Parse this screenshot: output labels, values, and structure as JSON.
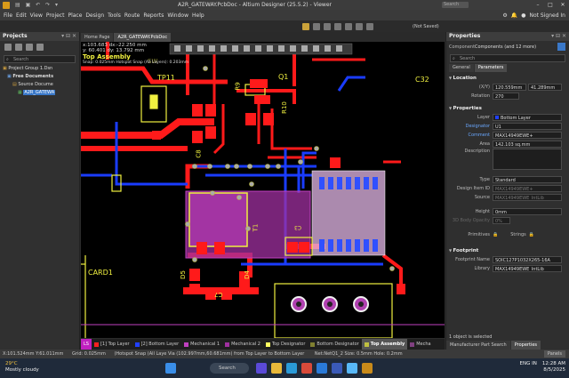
{
  "window": {
    "title": "A2R_GATEWAY.PcbDoc - Altium Designer (25.5.2) - Viewer",
    "search_label": "Search",
    "buttons": [
      "minimize",
      "maximize",
      "close"
    ]
  },
  "menu": {
    "items": [
      "File",
      "Edit",
      "View",
      "Project",
      "Place",
      "Design",
      "Tools",
      "Route",
      "Reports",
      "Window",
      "Help"
    ],
    "not_signed_in": "Not Signed In",
    "not_saved": "(Not Saved)"
  },
  "projects": {
    "title": "Projects",
    "search_placeholder": "Search",
    "tree": [
      {
        "label": "Project Group 1.Dsn",
        "depth": 0
      },
      {
        "label": "Free Documents",
        "depth": 1
      },
      {
        "label": "Source Docume",
        "depth": 2
      },
      {
        "label": "A2R_GATEWA",
        "depth": 3,
        "selected": true
      }
    ]
  },
  "doc_tabs": [
    {
      "label": "Home Page",
      "active": false
    },
    {
      "label": "A2R_GATEWAY.PcbDoc",
      "active": true
    }
  ],
  "hud": {
    "line1": "x:103.683   dx:-22.250 mm",
    "line2": "y: 60.401   dy: 13.792 mm",
    "line3": "Top Assembly",
    "line4": "Snap: 0.025mm Hotspot Snap (All Layers): 0.203mm"
  },
  "pcb_labels": {
    "q1": "Q1",
    "c32": "C32",
    "tp11": "TP11",
    "r9": "R9",
    "r10": "R10",
    "c8": "C8",
    "t1": "T1",
    "d5": "D5",
    "d4": "D4",
    "c7": "C7",
    "card1": "CARD1",
    "sw": "SW",
    "c3": "C3"
  },
  "layers": [
    {
      "label": "LS",
      "color": "#c020c0"
    },
    {
      "label": "[1] Top Layer",
      "color": "#ff2020"
    },
    {
      "label": "[2] Bottom Layer",
      "color": "#2040ff"
    },
    {
      "label": "Mechanical 1",
      "color": "#c040c0"
    },
    {
      "label": "Mechanical 2",
      "color": "#a030a0"
    },
    {
      "label": "Top Designator",
      "color": "#ffff60"
    },
    {
      "label": "Bottom Designator",
      "color": "#808030"
    },
    {
      "label": "Top Assembly",
      "color": "#c0c040",
      "active": true
    },
    {
      "label": "Mecha",
      "color": "#804080"
    }
  ],
  "properties": {
    "title": "Properties",
    "component_label": "Component",
    "component_value": "Components (and 12 more)",
    "search_placeholder": "Search",
    "tabs": [
      "General",
      "Parameters"
    ],
    "location_header": "Location",
    "xy_label": "(X/Y)",
    "x_value": "120.559mm",
    "y_value": "41.289mm",
    "rotation_label": "Rotation",
    "rotation_value": "270",
    "properties_header": "Properties",
    "layer_label": "Layer",
    "layer_value": "Bottom Layer",
    "designator_label": "Designator",
    "designator_value": "U1",
    "comment_label": "Comment",
    "comment_value": "MAX14949EWE+",
    "area_label": "Area",
    "area_value": "142.103 sq.mm",
    "description_label": "Description",
    "type_label": "Type",
    "type_value": "Standard",
    "design_item_label": "Design Item ID",
    "design_item_value": "MAX14949EWE+",
    "source_label": "Source",
    "source_value": "MAX14949EWE_IntLib",
    "height_label": "Height",
    "height_value": "0mm",
    "opacity_label": "3D Body Opacity",
    "opacity_value": "0%",
    "primitives_label": "Primitives",
    "strings_label": "Strings",
    "footprint_header": "Footprint",
    "fp_name_label": "Footprint Name",
    "fp_name_value": "SOIC127P1032X265-16A",
    "library_label": "Library",
    "library_value": "MAX14949EWE_IntLib",
    "selected_text": "1 object is selected",
    "bottom_tabs": [
      "Manufacturer Part Search",
      "Properties"
    ]
  },
  "status": {
    "coords": "X:101.524mm Y:61.011mm",
    "grid": "Grid: 0.025mm",
    "snap": "(Hotspot Snap (All Laye  Via (102.997mm,60.681mm) from Top Layer to Bottom Layer",
    "net": "Net:NetQ1_2 Size: 0.5mm Hole: 0.2mm",
    "panels": "Panels"
  },
  "taskbar": {
    "temp": "29°C",
    "weather": "Mostly cloudy",
    "search": "Search",
    "lang": "ENG IN",
    "time": "12:28 AM",
    "date": "8/5/2025"
  },
  "colors": {
    "top_copper": "#ff1a1a",
    "bottom_copper": "#1a3cff",
    "silk": "#f0f040",
    "mech": "#c040c0",
    "board_bg": "#000000"
  }
}
